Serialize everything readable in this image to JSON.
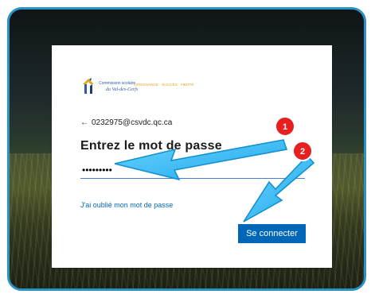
{
  "login": {
    "logo": {
      "org_line1": "Commission scolaire",
      "org_line2": "du Val-des-Cerfs",
      "tagline": "CROISSANCE · SUCCÈS · FIERTÉ"
    },
    "back_icon": "←",
    "email": "0232975@csvdc.qc.ca",
    "title": "Entrez le mot de passe",
    "password_value": "•••••••••",
    "forgot_label": "J'ai oublié mon mot de passe",
    "signin_label": "Se connecter"
  },
  "annotations": {
    "step1": "1",
    "step2": "2"
  },
  "colors": {
    "frame": "#2a93c6",
    "arrow": "#29b0ea",
    "badge": "#e81f1f",
    "primary": "#0067b8"
  }
}
